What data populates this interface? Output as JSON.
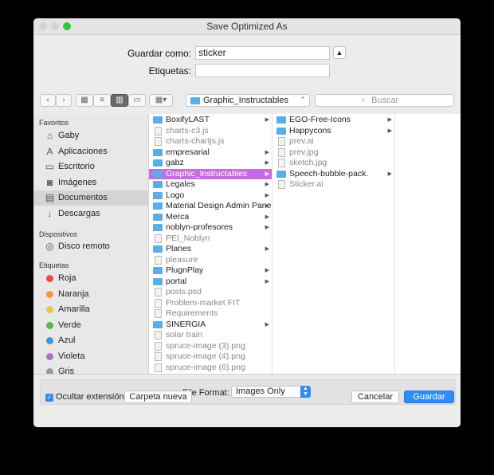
{
  "window": {
    "title": "Save Optimized As"
  },
  "form": {
    "save_as_label": "Guardar como:",
    "save_as_value": "sticker",
    "tags_label": "Etiquetas:",
    "tags_value": ""
  },
  "toolbar": {
    "back": "‹",
    "forward": "›",
    "location": "Graphic_Instructables",
    "search_placeholder": "Buscar"
  },
  "sidebar": {
    "favorites_heading": "Favoritos",
    "favorites": [
      {
        "label": "Gaby",
        "icon": "home-icon"
      },
      {
        "label": "Aplicaciones",
        "icon": "applications-icon"
      },
      {
        "label": "Escritorio",
        "icon": "desktop-icon"
      },
      {
        "label": "Imágenes",
        "icon": "camera-icon"
      },
      {
        "label": "Documentos",
        "icon": "documents-icon"
      },
      {
        "label": "Descargas",
        "icon": "download-icon"
      }
    ],
    "devices_heading": "Dispositivos",
    "devices": [
      {
        "label": "Disco remoto",
        "icon": "disc-icon"
      }
    ],
    "tags_heading": "Etiquetas",
    "tags": [
      {
        "label": "Roja",
        "color": "#e84d3d"
      },
      {
        "label": "Naranja",
        "color": "#f19a38"
      },
      {
        "label": "Amarilla",
        "color": "#e8c547"
      },
      {
        "label": "Verde",
        "color": "#52b847"
      },
      {
        "label": "Azul",
        "color": "#3a9ad9"
      },
      {
        "label": "Violeta",
        "color": "#b76dc9"
      },
      {
        "label": "Gris",
        "color": "#9a9a9a"
      }
    ]
  },
  "column1": [
    {
      "label": "BoxifyLAST",
      "type": "folder",
      "arrow": true
    },
    {
      "label": "charts-c3.js",
      "type": "file",
      "grey": true
    },
    {
      "label": "charts-chartjs.js",
      "type": "file",
      "grey": true
    },
    {
      "label": "empresarial",
      "type": "folder",
      "arrow": true
    },
    {
      "label": "gabz",
      "type": "folder",
      "arrow": true
    },
    {
      "label": "Graphic_Instructables",
      "type": "folder",
      "arrow": true,
      "selected": true
    },
    {
      "label": "Legales",
      "type": "folder",
      "arrow": true
    },
    {
      "label": "Logo",
      "type": "folder",
      "arrow": true
    },
    {
      "label": "Material Design Admin Panel",
      "type": "folder",
      "arrow": true
    },
    {
      "label": "Merca",
      "type": "folder",
      "arrow": true
    },
    {
      "label": "noblyn-profesores",
      "type": "folder",
      "arrow": true
    },
    {
      "label": "PEI_Noblyn",
      "type": "file",
      "grey": true
    },
    {
      "label": "Planes",
      "type": "folder",
      "arrow": true
    },
    {
      "label": "pleasure",
      "type": "file",
      "grey": true
    },
    {
      "label": "PlugnPlay",
      "type": "folder",
      "arrow": true
    },
    {
      "label": "portal",
      "type": "folder",
      "arrow": true
    },
    {
      "label": "posts.psd",
      "type": "file",
      "grey": true
    },
    {
      "label": "Problem-market FIT",
      "type": "file",
      "grey": true
    },
    {
      "label": "Requirements",
      "type": "file",
      "grey": true
    },
    {
      "label": "SINERGIA",
      "type": "folder",
      "arrow": true
    },
    {
      "label": "solar train",
      "type": "file",
      "grey": true
    },
    {
      "label": "spruce-image (3).png",
      "type": "file",
      "grey": true
    },
    {
      "label": "spruce-image (4).png",
      "type": "file",
      "grey": true
    },
    {
      "label": "spruce-image (6).png",
      "type": "file",
      "grey": true
    }
  ],
  "column2": [
    {
      "label": "EGO-Free-Icons",
      "type": "folder",
      "arrow": true
    },
    {
      "label": "Happycons",
      "type": "folder",
      "arrow": true
    },
    {
      "label": "prev.ai",
      "type": "file",
      "grey": true
    },
    {
      "label": "prev.jpg",
      "type": "file",
      "grey": true
    },
    {
      "label": "sketch.jpg",
      "type": "file",
      "grey": true
    },
    {
      "label": "Speech-bubble-pack.",
      "type": "folder",
      "arrow": true
    },
    {
      "label": "Sticker.ai",
      "type": "file",
      "grey": true
    }
  ],
  "footer": {
    "file_format_label": "File Format:",
    "file_format_value": "Images Only",
    "hide_extension_label": "Ocultar extensión",
    "new_folder_label": "Carpeta nueva",
    "cancel_label": "Cancelar",
    "save_label": "Guardar"
  }
}
